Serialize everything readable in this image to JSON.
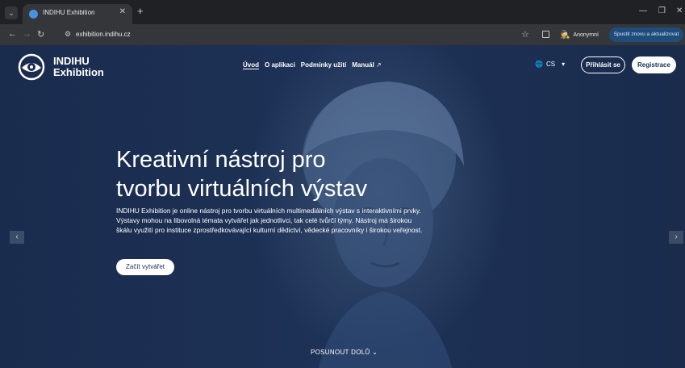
{
  "browser": {
    "tab_title": "INDIHU Exhibition",
    "url": "exhibition.indihu.cz",
    "profile_label": "Anonymní",
    "update_label": "Spustit znovu a aktualizovat"
  },
  "header": {
    "logo_line1": "INDIHU",
    "logo_line2": "Exhibition",
    "nav": [
      "Úvod",
      "O aplikaci",
      "Podmínky užití",
      "Manuál"
    ],
    "language": "CS",
    "login": "Přihlásit se",
    "register": "Registrace"
  },
  "hero": {
    "title_line1": "Kreativní nástroj pro",
    "title_line2": "tvorbu virtuálních výstav",
    "description": "INDIHU Exhibition je online nástroj pro tvorbu virtuálních multimediálních výstav s interaktivními prvky. Výstavy mohou na libovolná témata vytvářet jak jednotlivci, tak celé tvůrčí týmy. Nástroj má širokou škálu využití pro instituce zprostředkovávající kulturní dědictví, vědecké pracovníky i širokou veřejnost.",
    "cta": "Začít vytvářet",
    "scroll_label": "POSUNOUT DOLŮ"
  },
  "colors": {
    "page_bg": "#1b2f52",
    "browser_dark": "#202124",
    "white": "#ffffff"
  }
}
